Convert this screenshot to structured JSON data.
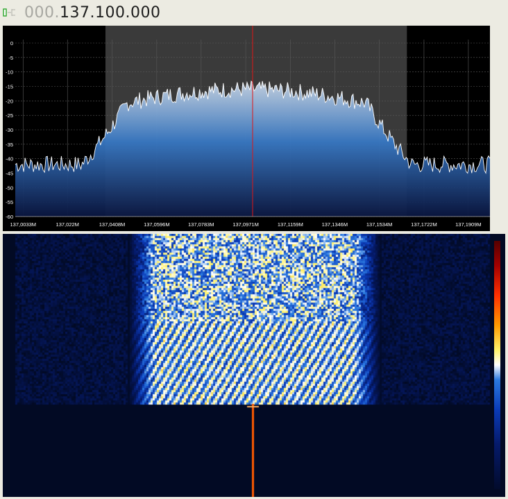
{
  "frequency": {
    "dim_prefix": "000.",
    "main": "137.100.000"
  },
  "colors": {
    "band_overlay": "#3a3a3a",
    "trace": "#ffffff",
    "fill_top": "#c9d6e6",
    "fill_mid": "#3777c2",
    "fill_bottom": "#0a1640",
    "center_marker": "#e01515",
    "grid": "#5a5a5a"
  },
  "chart_data": {
    "type": "area",
    "ylim": [
      -60,
      0
    ],
    "y_ticks": [
      "0",
      "-5",
      "-10",
      "-15",
      "-20",
      "-25",
      "-30",
      "-35",
      "-40",
      "-45",
      "-50",
      "-55",
      "-60"
    ],
    "x_range_mhz": [
      137.0,
      137.2
    ],
    "x_ticks": [
      {
        "value": 137.0033,
        "label": "137,0033M"
      },
      {
        "value": 137.022,
        "label": "137,022M"
      },
      {
        "value": 137.0408,
        "label": "137,0408M"
      },
      {
        "value": 137.0596,
        "label": "137,0596M"
      },
      {
        "value": 137.0783,
        "label": "137,0783M"
      },
      {
        "value": 137.0971,
        "label": "137,0971M"
      },
      {
        "value": 137.1159,
        "label": "137,1159M"
      },
      {
        "value": 137.1346,
        "label": "137,1346M"
      },
      {
        "value": 137.1534,
        "label": "137,1534M"
      },
      {
        "value": 137.1722,
        "label": "137,1722M"
      },
      {
        "value": 137.1909,
        "label": "137,1909M"
      }
    ],
    "filter_band_mhz": [
      137.038,
      137.165
    ],
    "center_mhz": 137.1,
    "noise_floor_db": -42,
    "signal_peak_db": -16,
    "signal_edges_mhz": [
      137.04,
      137.155
    ]
  },
  "waterfall": {
    "signal_band_mhz": [
      137.05,
      137.151
    ],
    "carrier_mhz": 137.1
  }
}
